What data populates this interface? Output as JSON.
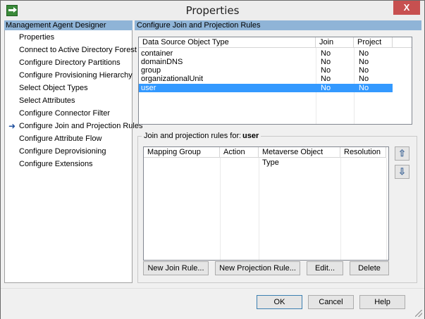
{
  "window": {
    "title": "Properties",
    "close_label": "X"
  },
  "sidebar": {
    "header": "Management Agent Designer",
    "items": [
      {
        "label": "Properties"
      },
      {
        "label": "Connect to Active Directory Forest"
      },
      {
        "label": "Configure Directory Partitions"
      },
      {
        "label": "Configure Provisioning Hierarchy"
      },
      {
        "label": "Select Object Types"
      },
      {
        "label": "Select Attributes"
      },
      {
        "label": "Configure Connector Filter"
      },
      {
        "label": "Configure Join and Projection Rules",
        "current": true
      },
      {
        "label": "Configure Attribute Flow"
      },
      {
        "label": "Configure Deprovisioning"
      },
      {
        "label": "Configure Extensions"
      }
    ]
  },
  "main": {
    "header": "Configure Join and Projection Rules",
    "object_types": {
      "columns": [
        "Data Source Object Type",
        "Join",
        "Project"
      ],
      "rows": [
        {
          "type": "container",
          "join": "No",
          "project": "No"
        },
        {
          "type": "domainDNS",
          "join": "No",
          "project": "No"
        },
        {
          "type": "group",
          "join": "No",
          "project": "No"
        },
        {
          "type": "organizationalUnit",
          "join": "No",
          "project": "No"
        },
        {
          "type": "user",
          "join": "No",
          "project": "No",
          "selected": true
        }
      ]
    },
    "rules": {
      "label": "Join and projection rules for:",
      "selected_type": "user",
      "columns": [
        "Mapping Group",
        "Action",
        "Metaverse Object Type",
        "Resolution"
      ],
      "buttons": {
        "new_join": "New Join Rule...",
        "new_projection": "New Projection Rule...",
        "edit": "Edit...",
        "delete": "Delete"
      },
      "move_up_icon": "arrow-up",
      "move_down_icon": "arrow-down"
    }
  },
  "footer": {
    "ok": "OK",
    "cancel": "Cancel",
    "help": "Help"
  },
  "colors": {
    "header_bg": "#8fb4d7",
    "selection": "#3399ff",
    "close": "#c75050"
  }
}
